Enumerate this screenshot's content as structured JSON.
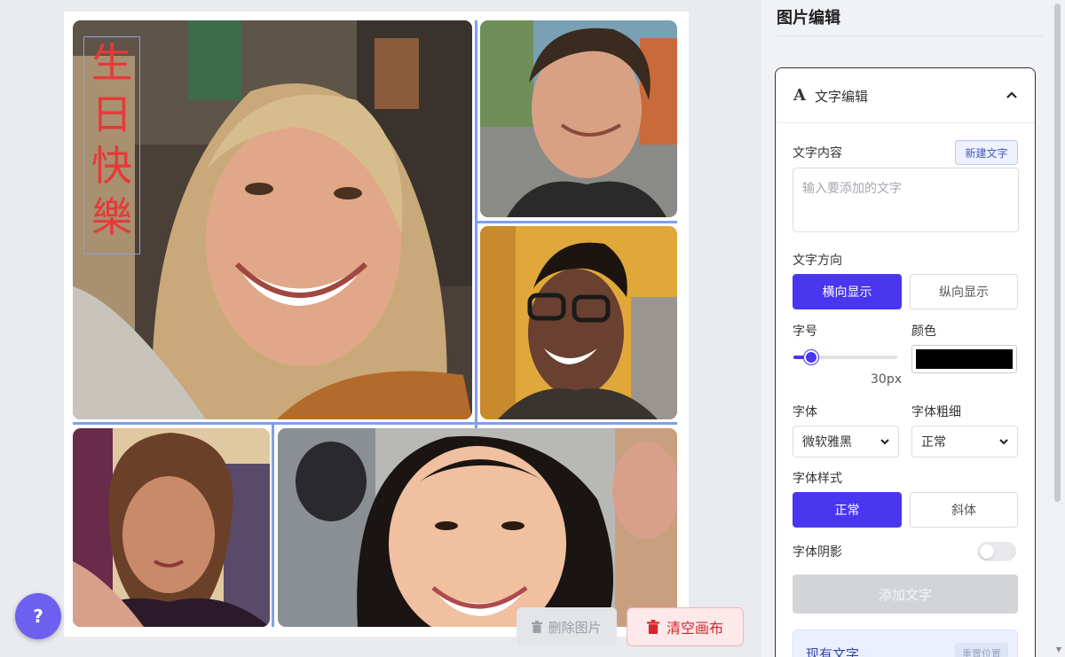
{
  "canvas": {
    "overlay_text": [
      "生",
      "日",
      "快",
      "樂"
    ]
  },
  "help": {
    "label": "?"
  },
  "actions": {
    "delete_image": "删除图片",
    "clear_canvas": "清空画布"
  },
  "panel": {
    "title": "图片编辑",
    "text_edit": {
      "title": "文字编辑",
      "content_label": "文字内容",
      "new_text_button": "新建文字",
      "textarea_placeholder": "输入要添加的文字",
      "direction_label": "文字方向",
      "direction_horizontal": "横向显示",
      "direction_vertical": "纵向显示",
      "size_label": "字号",
      "size_value": "30px",
      "size_level": 0.17,
      "color_label": "颜色",
      "color_value": "#000000",
      "font_label": "字体",
      "font_value": "微软雅黑",
      "weight_label": "字体粗细",
      "weight_value": "正常",
      "style_label": "字体样式",
      "style_normal": "正常",
      "style_italic": "斜体",
      "shadow_label": "字体阴影",
      "shadow_on": false,
      "add_text_button": "添加文字",
      "existing_title": "现有文字",
      "existing_button": "重置位置"
    }
  },
  "colors": {
    "accent": "#4b36f0",
    "overlay_text": "#e53a3a",
    "danger": "#d4262f",
    "guide": "#7ea0ee"
  }
}
